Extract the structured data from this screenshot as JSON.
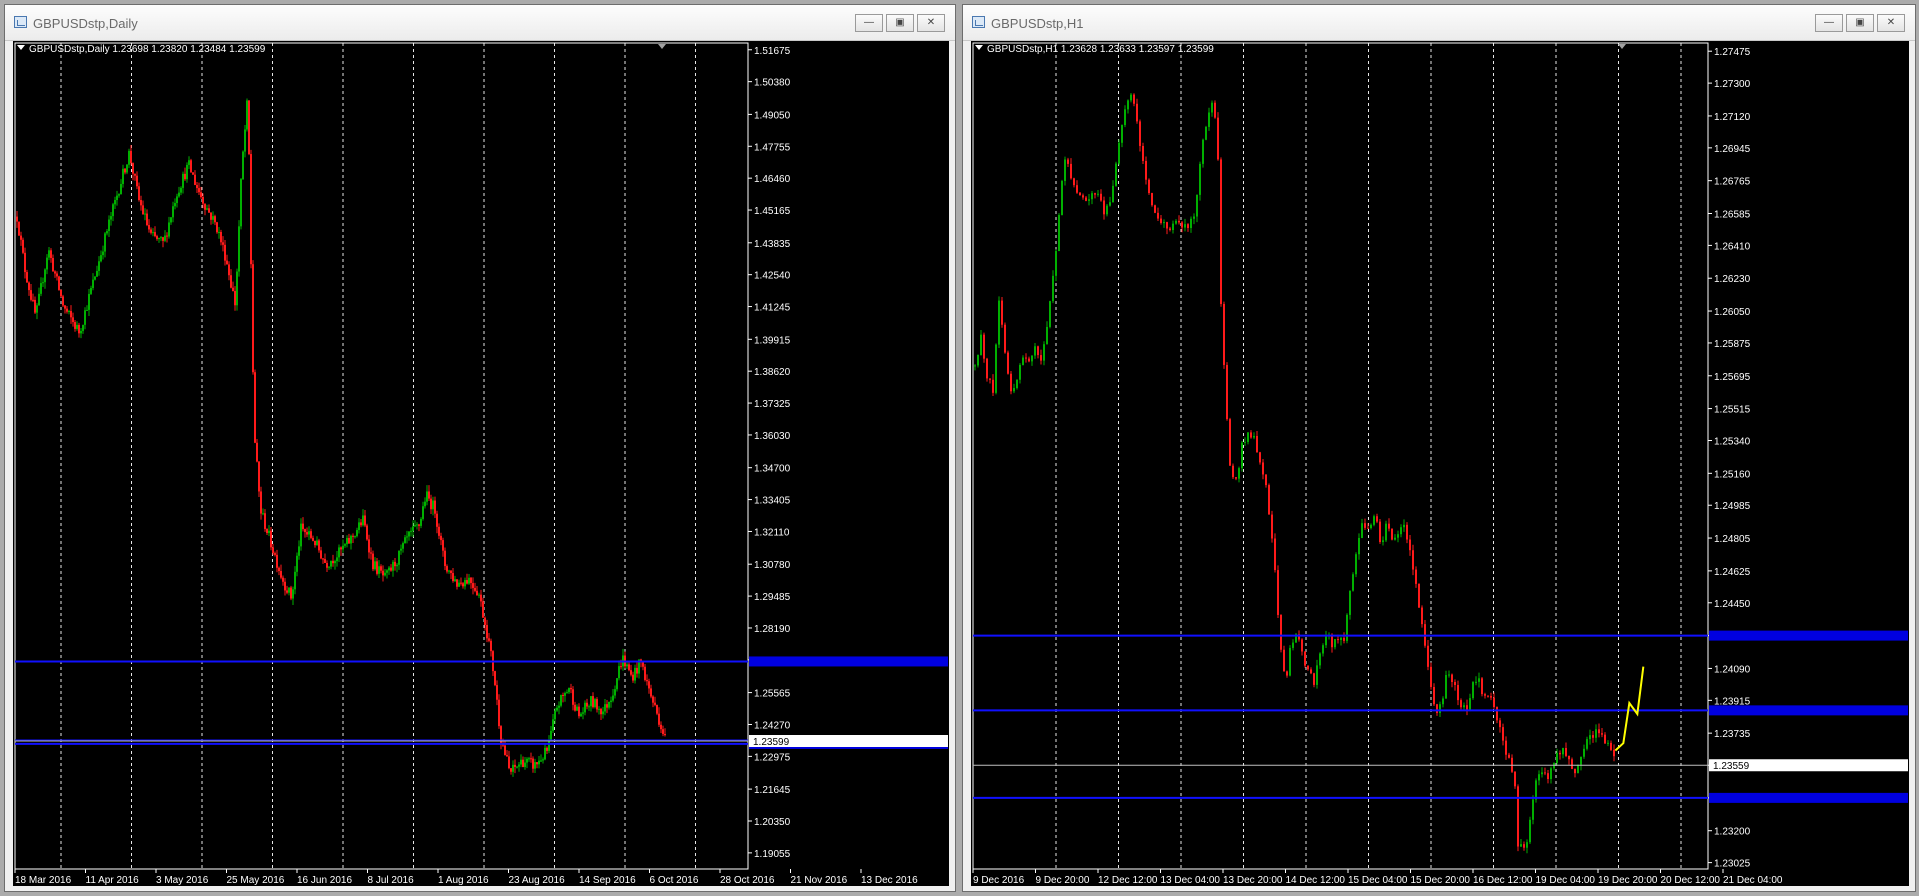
{
  "windows": [
    {
      "title": "GBPUSDstp,Daily",
      "header": "GBPUSDstp,Daily  1.23698 1.23820 1.23484 1.23599",
      "chart_data": {
        "type": "candlestick",
        "symbol": "GBPUSDstp",
        "timeframe": "Daily",
        "ohlc_header": [
          1.23698,
          1.2382,
          1.23484,
          1.23599
        ],
        "ylim": [
          1.184,
          1.5195
        ],
        "y_ticks": [
          1.51675,
          1.5038,
          1.4905,
          1.47755,
          1.4646,
          1.45165,
          1.43835,
          1.4254,
          1.41245,
          1.39915,
          1.3862,
          1.37325,
          1.3603,
          1.347,
          1.33405,
          1.3211,
          1.3078,
          1.29485,
          1.2819,
          1.26895,
          1.25565,
          1.2427,
          1.22975,
          1.21645,
          1.2035,
          1.19055
        ],
        "x_labels": [
          "18 Mar 2016",
          "11 Apr 2016",
          "3 May 2016",
          "25 May 2016",
          "16 Jun 2016",
          "8 Jul 2016",
          "1 Aug 2016",
          "23 Aug 2016",
          "14 Sep 2016",
          "6 Oct 2016",
          "28 Oct 2016",
          "21 Nov 2016",
          "13 Dec 2016"
        ],
        "grid": true,
        "horizontal_lines": [
          1.2683,
          1.2362,
          1.2348
        ],
        "price_line": 1.23599,
        "price_label": "1.23599",
        "path": [
          [
            0,
            1.449
          ],
          [
            5,
            1.428
          ],
          [
            12,
            1.408
          ],
          [
            20,
            1.436
          ],
          [
            30,
            1.412
          ],
          [
            40,
            1.402
          ],
          [
            50,
            1.425
          ],
          [
            58,
            1.444
          ],
          [
            66,
            1.462
          ],
          [
            72,
            1.475
          ],
          [
            78,
            1.456
          ],
          [
            86,
            1.441
          ],
          [
            94,
            1.438
          ],
          [
            102,
            1.458
          ],
          [
            110,
            1.47
          ],
          [
            116,
            1.46
          ],
          [
            122,
            1.452
          ],
          [
            128,
            1.445
          ],
          [
            134,
            1.432
          ],
          [
            140,
            1.413
          ],
          [
            144,
            1.468
          ],
          [
            148,
            1.498
          ],
          [
            152,
            1.362
          ],
          [
            156,
            1.33
          ],
          [
            162,
            1.318
          ],
          [
            170,
            1.302
          ],
          [
            176,
            1.294
          ],
          [
            182,
            1.322
          ],
          [
            190,
            1.318
          ],
          [
            198,
            1.308
          ],
          [
            206,
            1.312
          ],
          [
            214,
            1.318
          ],
          [
            222,
            1.326
          ],
          [
            228,
            1.308
          ],
          [
            236,
            1.302
          ],
          [
            244,
            1.31
          ],
          [
            250,
            1.318
          ],
          [
            258,
            1.324
          ],
          [
            262,
            1.336
          ],
          [
            268,
            1.33
          ],
          [
            274,
            1.308
          ],
          [
            282,
            1.3
          ],
          [
            290,
            1.302
          ],
          [
            296,
            1.296
          ],
          [
            302,
            1.278
          ],
          [
            306,
            1.262
          ],
          [
            310,
            1.238
          ],
          [
            316,
            1.223
          ],
          [
            324,
            1.228
          ],
          [
            332,
            1.226
          ],
          [
            340,
            1.232
          ],
          [
            346,
            1.25
          ],
          [
            354,
            1.258
          ],
          [
            360,
            1.246
          ],
          [
            368,
            1.252
          ],
          [
            376,
            1.248
          ],
          [
            382,
            1.256
          ],
          [
            388,
            1.27
          ],
          [
            394,
            1.262
          ],
          [
            400,
            1.268
          ],
          [
            406,
            1.255
          ],
          [
            412,
            1.244
          ],
          [
            416,
            1.236
          ]
        ]
      }
    },
    {
      "title": "GBPUSDstp,H1",
      "header": "GBPUSDstp,H1  1.23628 1.23633 1.23597 1.23599",
      "chart_data": {
        "type": "candlestick",
        "symbol": "GBPUSDstp",
        "timeframe": "H1",
        "ohlc_header": [
          1.23628,
          1.23633,
          1.23597,
          1.23599
        ],
        "ylim": [
          1.2299,
          1.2752
        ],
        "y_ticks": [
          1.27475,
          1.273,
          1.2712,
          1.26945,
          1.26765,
          1.26585,
          1.2641,
          1.2623,
          1.2605,
          1.25875,
          1.25695,
          1.25515,
          1.2534,
          1.2516,
          1.24985,
          1.24805,
          1.24625,
          1.2445,
          1.2427,
          1.2409,
          1.23915,
          1.23735,
          1.23559,
          1.2338,
          1.232,
          1.23025
        ],
        "x_labels": [
          "9 Dec 2016",
          "9 Dec 20:00",
          "12 Dec 12:00",
          "13 Dec 04:00",
          "13 Dec 20:00",
          "14 Dec 12:00",
          "15 Dec 04:00",
          "15 Dec 20:00",
          "16 Dec 12:00",
          "19 Dec 04:00",
          "19 Dec 20:00",
          "20 Dec 12:00",
          "21 Dec 04:00"
        ],
        "grid": true,
        "horizontal_lines": [
          1.2427,
          1.2386,
          1.2338
        ],
        "price_line": 1.23559,
        "price_label": "1.23559",
        "path": [
          [
            0,
            1.2575
          ],
          [
            6,
            1.259
          ],
          [
            12,
            1.257
          ],
          [
            18,
            1.256
          ],
          [
            24,
            1.2615
          ],
          [
            30,
            1.258
          ],
          [
            36,
            1.256
          ],
          [
            42,
            1.257
          ],
          [
            48,
            1.258
          ],
          [
            54,
            1.2575
          ],
          [
            60,
            1.2585
          ],
          [
            66,
            1.2575
          ],
          [
            72,
            1.26
          ],
          [
            78,
            1.2625
          ],
          [
            84,
            1.2665
          ],
          [
            90,
            1.269
          ],
          [
            96,
            1.2675
          ],
          [
            104,
            1.267
          ],
          [
            112,
            1.2665
          ],
          [
            120,
            1.267
          ],
          [
            128,
            1.266
          ],
          [
            136,
            1.267
          ],
          [
            142,
            1.2695
          ],
          [
            148,
            1.2715
          ],
          [
            156,
            1.2725
          ],
          [
            162,
            1.27
          ],
          [
            168,
            1.268
          ],
          [
            176,
            1.266
          ],
          [
            184,
            1.2655
          ],
          [
            192,
            1.265
          ],
          [
            200,
            1.2655
          ],
          [
            206,
            1.265
          ],
          [
            212,
            1.2652
          ],
          [
            218,
            1.266
          ],
          [
            224,
            1.269
          ],
          [
            230,
            1.2712
          ],
          [
            236,
            1.2718
          ],
          [
            240,
            1.2705
          ],
          [
            244,
            1.26
          ],
          [
            248,
            1.256
          ],
          [
            252,
            1.252
          ],
          [
            258,
            1.251
          ],
          [
            264,
            1.253
          ],
          [
            270,
            1.254
          ],
          [
            276,
            1.2535
          ],
          [
            282,
            1.2525
          ],
          [
            288,
            1.251
          ],
          [
            292,
            1.249
          ],
          [
            296,
            1.247
          ],
          [
            300,
            1.244
          ],
          [
            304,
            1.241
          ],
          [
            308,
            1.24
          ],
          [
            312,
            1.242
          ],
          [
            318,
            1.243
          ],
          [
            324,
            1.2415
          ],
          [
            330,
            1.241
          ],
          [
            336,
            1.2402
          ],
          [
            342,
            1.242
          ],
          [
            348,
            1.243
          ],
          [
            354,
            1.2422
          ],
          [
            360,
            1.2425
          ],
          [
            366,
            1.2425
          ],
          [
            372,
            1.2455
          ],
          [
            378,
            1.2475
          ],
          [
            384,
            1.249
          ],
          [
            390,
            1.2485
          ],
          [
            396,
            1.2493
          ],
          [
            402,
            1.2478
          ],
          [
            408,
            1.2488
          ],
          [
            414,
            1.248
          ],
          [
            420,
            1.2483
          ],
          [
            426,
            1.2487
          ],
          [
            432,
            1.247
          ],
          [
            438,
            1.245
          ],
          [
            444,
            1.243
          ],
          [
            450,
            1.24
          ],
          [
            456,
            1.2385
          ],
          [
            462,
            1.239
          ],
          [
            468,
            1.241
          ],
          [
            474,
            1.24
          ],
          [
            480,
            1.239
          ],
          [
            486,
            1.2385
          ],
          [
            492,
            1.24
          ],
          [
            498,
            1.2405
          ],
          [
            504,
            1.2393
          ],
          [
            510,
            1.2395
          ],
          [
            516,
            1.2385
          ],
          [
            522,
            1.237
          ],
          [
            528,
            1.236
          ],
          [
            534,
            1.235
          ],
          [
            538,
            1.231
          ],
          [
            542,
            1.2315
          ],
          [
            546,
            1.231
          ],
          [
            550,
            1.233
          ],
          [
            556,
            1.235
          ],
          [
            562,
            1.2353
          ],
          [
            568,
            1.235
          ],
          [
            574,
            1.236
          ],
          [
            580,
            1.2365
          ],
          [
            586,
            1.236
          ],
          [
            592,
            1.2352
          ],
          [
            598,
            1.2355
          ],
          [
            604,
            1.2365
          ],
          [
            610,
            1.2373
          ],
          [
            616,
            1.2375
          ],
          [
            622,
            1.2372
          ],
          [
            628,
            1.2367
          ],
          [
            634,
            1.236
          ]
        ],
        "projection": [
          [
            1.2364,
            1.2368
          ],
          [
            1.239,
            1.2384
          ],
          [
            1.241
          ]
        ]
      }
    }
  ]
}
